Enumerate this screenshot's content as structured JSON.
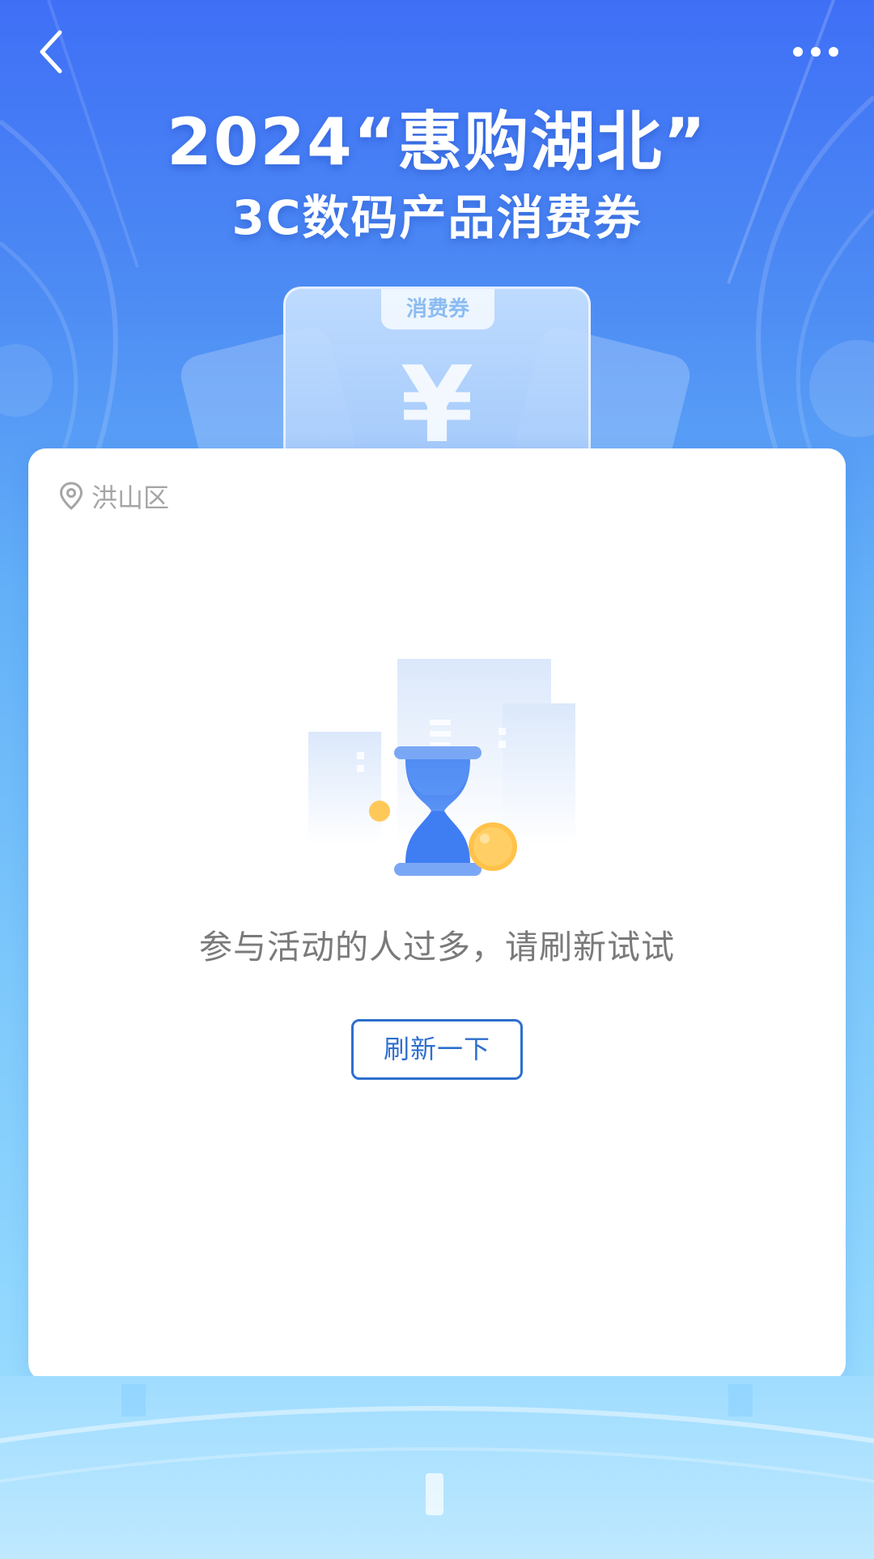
{
  "topbar": {
    "back_icon": "chevron-left-icon",
    "more_icon": "more-horizontal-icon"
  },
  "headline": {
    "line1": "2024“惠购湖北”",
    "line2": "3C数码产品消费券"
  },
  "voucher_illustration": {
    "tag": "消费券",
    "symbol": "¥"
  },
  "card": {
    "location": {
      "icon": "location-pin-icon",
      "text": "洪山区"
    },
    "illustration_icon": "hourglass-icon",
    "message": "参与活动的人过多，请刷新试试",
    "refresh_button": "刷新一下"
  },
  "colors": {
    "accent": "#2e6fcf",
    "background_top": "#3f6ff6",
    "background_bottom": "#a6e1ff",
    "card": "#ffffff",
    "muted_text": "#7a7a7a"
  }
}
